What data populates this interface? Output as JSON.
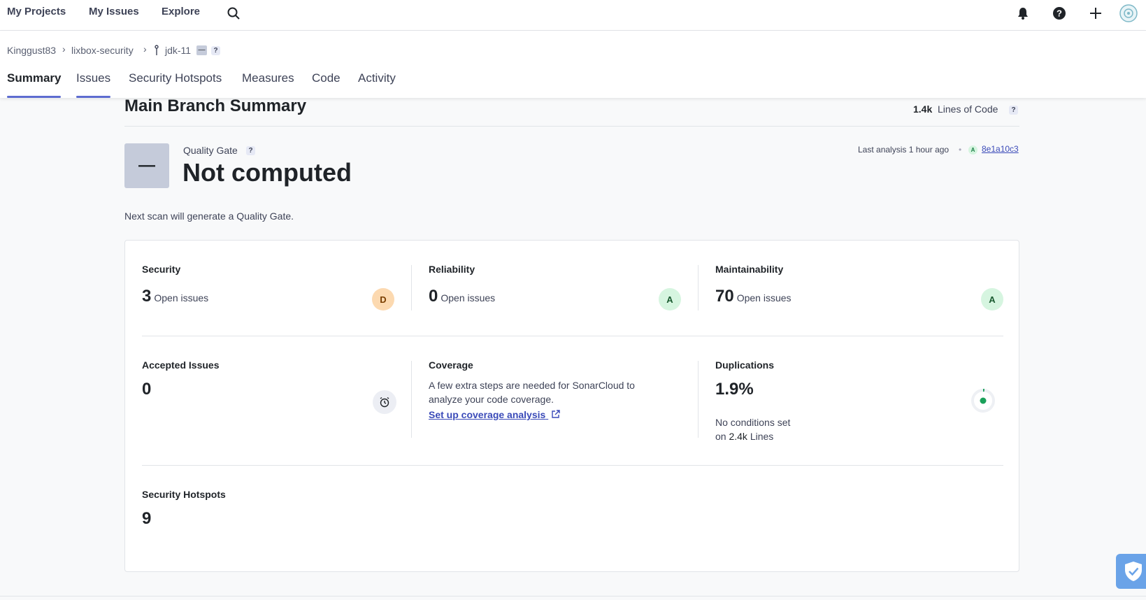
{
  "nav": {
    "my_projects": "My Projects",
    "my_issues": "My Issues",
    "explore": "Explore"
  },
  "breadcrumb": {
    "org": "Kinggust83",
    "project": "lixbox-security",
    "branch": "jdk-11",
    "badge": "—",
    "help": "?"
  },
  "tabs": [
    "Summary",
    "Issues",
    "Security Hotspots",
    "Measures",
    "Code",
    "Activity"
  ],
  "summary": {
    "title": "Main Branch Summary",
    "loc_value": "1.4k",
    "loc_label": "Lines of Code",
    "help": "?"
  },
  "quality_gate": {
    "symbol": "—",
    "label": "Quality Gate",
    "status": "Not computed",
    "note": "Next scan will generate a Quality Gate.",
    "last_analysis": "Last analysis 1 hour ago",
    "dot": "•",
    "commit_rating": "A",
    "commit": "8e1a10c3"
  },
  "metrics": {
    "security": {
      "label": "Security",
      "value": "3",
      "sub": "Open issues",
      "rating": "D"
    },
    "reliability": {
      "label": "Reliability",
      "value": "0",
      "sub": "Open issues",
      "rating": "A"
    },
    "maintainability": {
      "label": "Maintainability",
      "value": "70",
      "sub": "Open issues",
      "rating": "A"
    },
    "accepted": {
      "label": "Accepted Issues",
      "value": "0"
    },
    "coverage": {
      "label": "Coverage",
      "line1": "A few extra steps are needed for SonarCloud to",
      "line2": "analyze your code coverage.",
      "link": "Set up coverage analysis"
    },
    "duplications": {
      "label": "Duplications",
      "value": "1.9%",
      "line1": "No conditions set",
      "line2_prefix": "on",
      "line2_value": "2.4k",
      "line2_suffix": "Lines"
    },
    "hotspots": {
      "label": "Security Hotspots",
      "value": "9"
    }
  },
  "colors": {
    "accent": "#5d6cd0",
    "rating_d_bg": "#fcd9b0",
    "rating_a_bg": "#d6f5e0",
    "link": "#3a4ab8"
  }
}
